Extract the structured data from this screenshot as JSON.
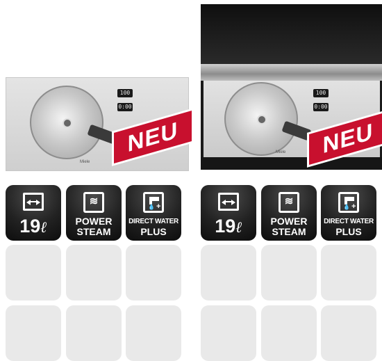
{
  "products": [
    {
      "id": "builtin",
      "badge": "NEU",
      "brand": "Miele",
      "display_top": "100",
      "display_bottom": "0:00",
      "features": [
        {
          "icon": "capacity-arrows-icon",
          "label": "19",
          "unit": "ℓ"
        },
        {
          "icon": "steam-icon",
          "line1": "POWER",
          "line2": "STEAM"
        },
        {
          "icon": "water-tap-icon",
          "line1": "DIRECT WATER",
          "line2": "PLUS"
        }
      ]
    },
    {
      "id": "column",
      "badge": "NEU",
      "brand": "Miele",
      "display_top": "100",
      "display_bottom": "0:00",
      "features": [
        {
          "icon": "capacity-arrows-icon",
          "label": "19",
          "unit": "ℓ"
        },
        {
          "icon": "steam-icon",
          "line1": "POWER",
          "line2": "STEAM"
        },
        {
          "icon": "water-tap-icon",
          "line1": "DIRECT WATER",
          "line2": "PLUS"
        }
      ]
    }
  ],
  "colors": {
    "badge": "#c8102e",
    "tile_dark": "#1a1a1a",
    "tile_empty": "#e9e9e9"
  }
}
